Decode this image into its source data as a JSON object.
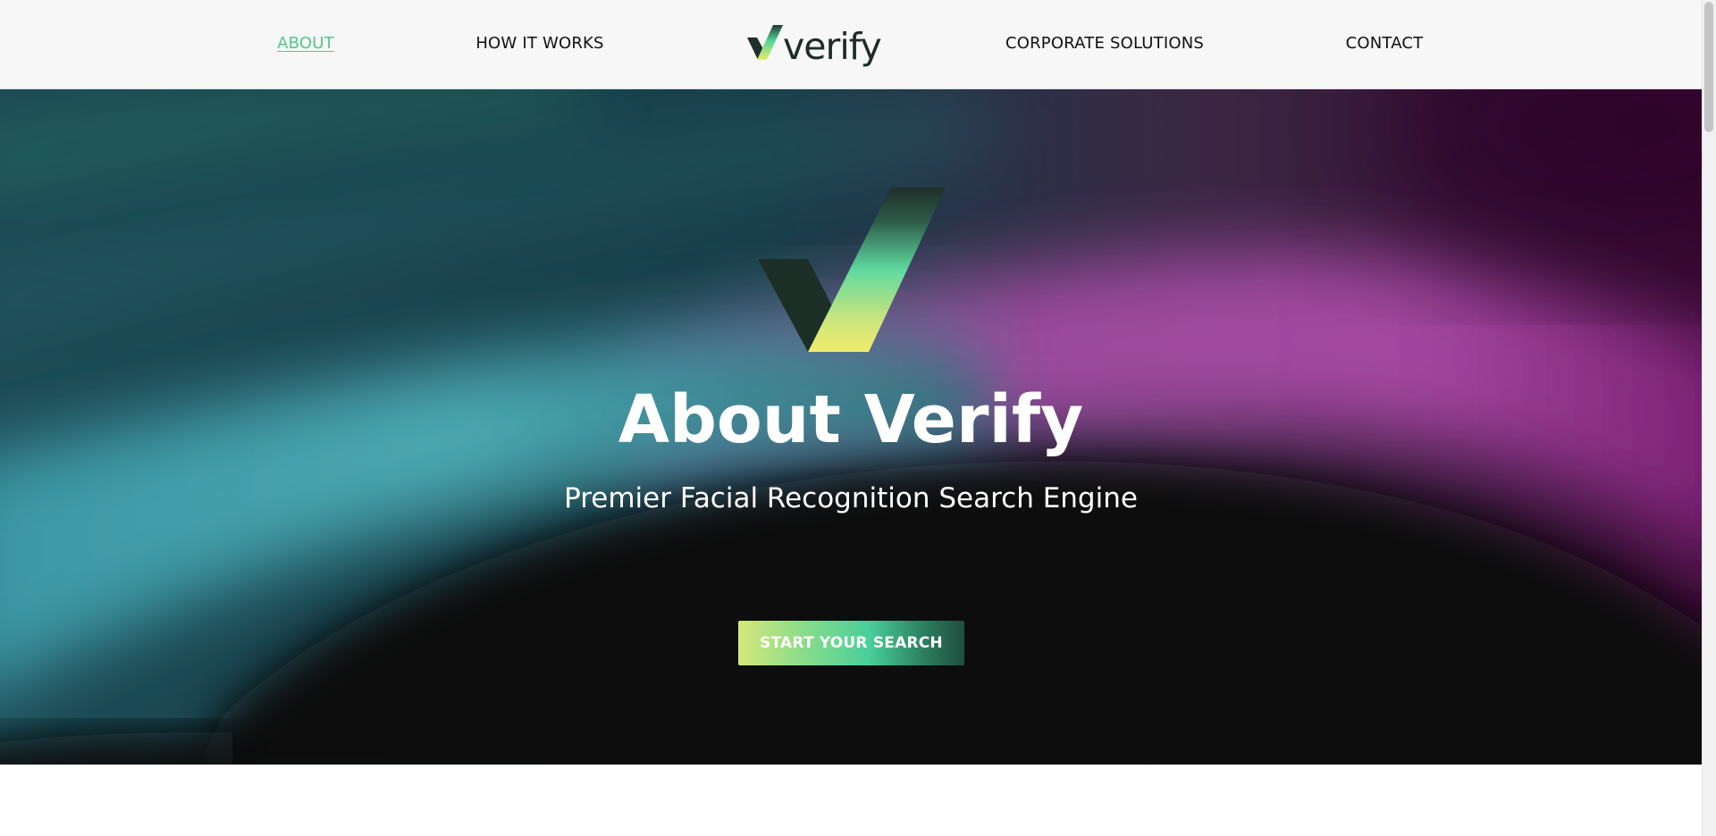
{
  "nav": {
    "about": "ABOUT",
    "how_it_works": "HOW IT WORKS",
    "corporate_solutions": "CORPORATE SOLUTIONS",
    "contact": "CONTACT",
    "active_color": "#4fc98c"
  },
  "logo": {
    "text": "verify"
  },
  "hero": {
    "title": "About Verify",
    "subtitle": "Premier Facial Recognition Search Engine",
    "cta_label": "START YOUR SEARCH"
  },
  "colors": {
    "brand_dark": "#1e2b27",
    "brand_green": "#48cf9a",
    "brand_yellow": "#e6ec6e",
    "hero_teal": "#3fa0ab",
    "hero_magenta": "#b04ca8"
  }
}
